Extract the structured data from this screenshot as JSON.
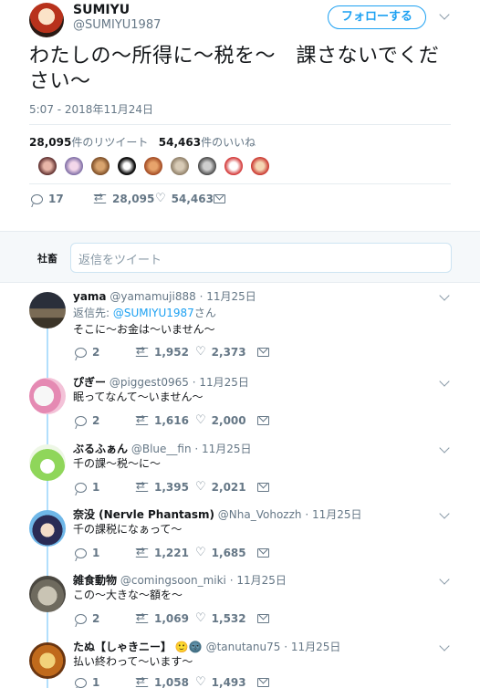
{
  "tweet": {
    "author_name": "SUMIYU",
    "author_handle": "@SUMIYU1987",
    "follow_label": "フォローする",
    "text": "わたしの〜所得に〜税を〜　課さないでください〜",
    "timestamp": "5:07 - 2018年11月24日",
    "retweet_count": "28,095",
    "retweet_label": "件のリツイート",
    "like_count": "54,463",
    "like_label": "件のいいね",
    "likers": [
      "liker-1",
      "liker-2",
      "liker-3",
      "liker-4",
      "liker-5",
      "liker-6",
      "liker-7",
      "liker-8",
      "liker-9"
    ],
    "actions": {
      "replies": "17",
      "retweets": "28,095",
      "likes": "54,463"
    }
  },
  "reply_box": {
    "label": "社畜",
    "placeholder": "返信をツイート"
  },
  "replies": [
    {
      "name": "yama",
      "handle": "@yamamuji888",
      "date": "· 11月25日",
      "reply_to_prefix": "返信先:",
      "reply_to": "@SUMIYU1987",
      "reply_to_suffix": "さん",
      "text": "そこに〜お金は〜いません〜",
      "replies": "2",
      "retweets": "1,952",
      "likes": "2,373"
    },
    {
      "name": "ぴぎー",
      "handle": "@piggest0965",
      "date": "· 11月25日",
      "text": "眠ってなんて〜いません〜",
      "replies": "2",
      "retweets": "1,616",
      "likes": "2,000"
    },
    {
      "name": "ぶるふぁん",
      "handle": "@Blue__fin",
      "date": "· 11月25日",
      "text": "千の課〜税〜に〜",
      "replies": "1",
      "retweets": "1,395",
      "likes": "2,021"
    },
    {
      "name": "奈没 (Nervle Phantasm)",
      "handle": "@Nha_Vohozzh",
      "date": "· 11月25日",
      "text": "千の課税になぁって〜",
      "replies": "1",
      "retweets": "1,221",
      "likes": "1,685"
    },
    {
      "name": "雑食動物",
      "handle": "@comingsoon_miki",
      "date": "· 11月25日",
      "text": "この〜大きな〜額を〜",
      "replies": "2",
      "retweets": "1,069",
      "likes": "1,532"
    },
    {
      "name": "たぬ【しゃきニー】",
      "name_emoji": "🙂🌚",
      "handle": "@tanutanu75",
      "date": "· 11月25日",
      "text": "払い終わって〜います〜",
      "replies": "1",
      "retweets": "1,058",
      "likes": "1,493"
    }
  ],
  "colors": {
    "accent": "#1da1f2",
    "muted": "#657786",
    "thread": "#b2dffc"
  }
}
